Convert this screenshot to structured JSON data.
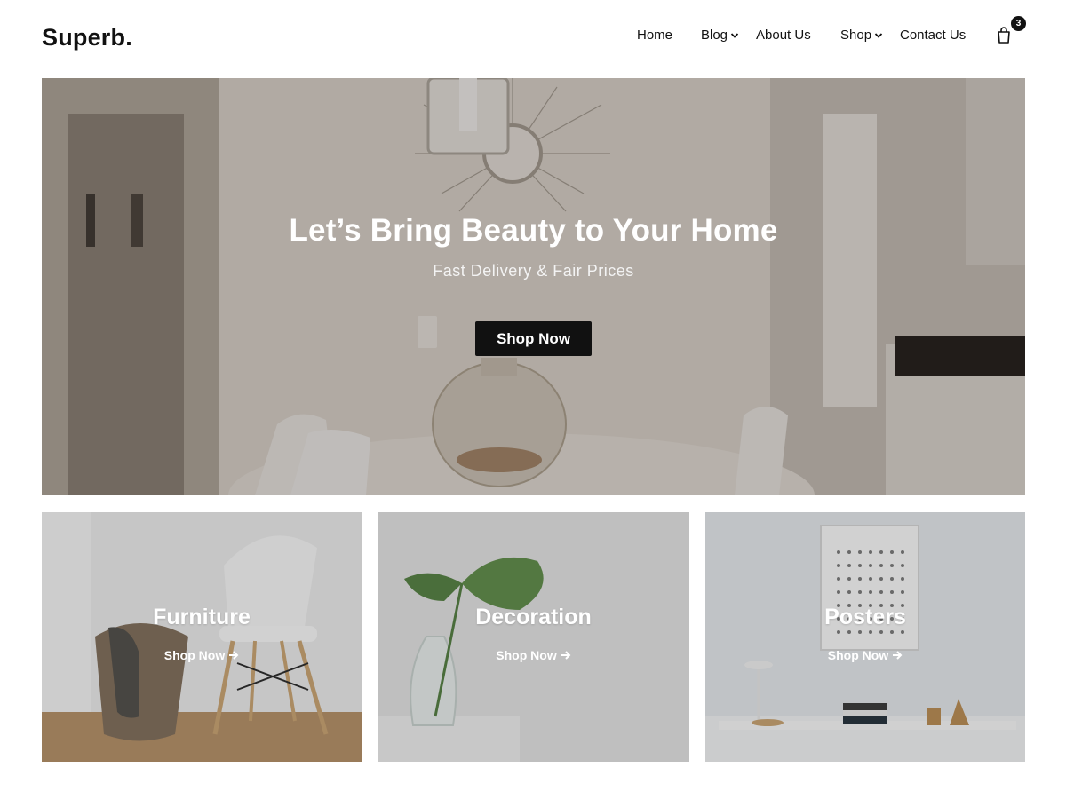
{
  "brand": {
    "logo": "Superb."
  },
  "nav": {
    "items": [
      {
        "label": "Home",
        "has_dropdown": false
      },
      {
        "label": "Blog",
        "has_dropdown": true
      },
      {
        "label": "About Us",
        "has_dropdown": false
      },
      {
        "label": "Shop",
        "has_dropdown": true
      },
      {
        "label": "Contact Us",
        "has_dropdown": false
      }
    ],
    "cart_icon": "shopping-bag-icon",
    "cart_count": "3"
  },
  "hero": {
    "title": "Let’s Bring Beauty to Your Home",
    "subtitle": "Fast Delivery & Fair Prices",
    "button_label": "Shop Now",
    "button_color": "#111111"
  },
  "categories": [
    {
      "title": "Furniture",
      "link_label": "Shop Now",
      "link_icon": "arrow-right-icon"
    },
    {
      "title": "Decoration",
      "link_label": "Shop Now",
      "link_icon": "arrow-right-icon"
    },
    {
      "title": "Posters",
      "link_label": "Shop Now",
      "link_icon": "arrow-right-icon"
    }
  ]
}
